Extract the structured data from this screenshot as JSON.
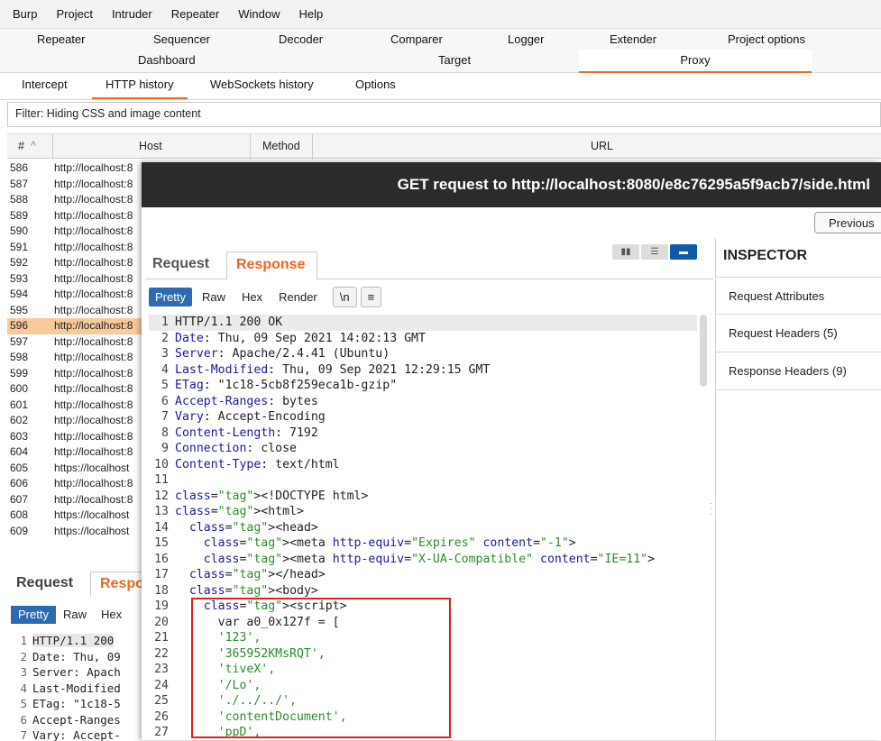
{
  "menu": [
    "Burp",
    "Project",
    "Intruder",
    "Repeater",
    "Window",
    "Help"
  ],
  "tool_tabs_row1": [
    "Repeater",
    "Sequencer",
    "Decoder",
    "Comparer",
    "Logger",
    "Extender",
    "Project options"
  ],
  "tool_tabs_row2": [
    "Dashboard",
    "Target",
    "Proxy"
  ],
  "proxy_tabs": [
    "Intercept",
    "HTTP history",
    "WebSockets history",
    "Options"
  ],
  "filter": "Filter: Hiding CSS and image content",
  "history": {
    "columns": [
      "#",
      "Host",
      "Method",
      "URL"
    ],
    "sort_indicator": "^",
    "rows": [
      {
        "num": "586",
        "host": "http://localhost:8"
      },
      {
        "num": "587",
        "host": "http://localhost:8"
      },
      {
        "num": "588",
        "host": "http://localhost:8"
      },
      {
        "num": "589",
        "host": "http://localhost:8"
      },
      {
        "num": "590",
        "host": "http://localhost:8"
      },
      {
        "num": "591",
        "host": "http://localhost:8"
      },
      {
        "num": "592",
        "host": "http://localhost:8"
      },
      {
        "num": "593",
        "host": "http://localhost:8"
      },
      {
        "num": "594",
        "host": "http://localhost:8"
      },
      {
        "num": "595",
        "host": "http://localhost:8"
      },
      {
        "num": "596",
        "host": "http://localhost:8"
      },
      {
        "num": "597",
        "host": "http://localhost:8"
      },
      {
        "num": "598",
        "host": "http://localhost:8"
      },
      {
        "num": "599",
        "host": "http://localhost:8"
      },
      {
        "num": "600",
        "host": "http://localhost:8"
      },
      {
        "num": "601",
        "host": "http://localhost:8"
      },
      {
        "num": "602",
        "host": "http://localhost:8"
      },
      {
        "num": "603",
        "host": "http://localhost:8"
      },
      {
        "num": "604",
        "host": "http://localhost:8"
      },
      {
        "num": "605",
        "host": "https://localhost"
      },
      {
        "num": "606",
        "host": "http://localhost:8"
      },
      {
        "num": "607",
        "host": "http://localhost:8"
      },
      {
        "num": "608",
        "host": "https://localhost"
      },
      {
        "num": "609",
        "host": "https://localhost"
      }
    ],
    "selected": "596"
  },
  "lower": {
    "tabs": [
      "Request",
      "Respo"
    ],
    "view": [
      "Pretty",
      "Raw",
      "Hex"
    ],
    "lines": [
      {
        "n": "1",
        "t": "HTTP/1.1 200"
      },
      {
        "n": "2",
        "t": "Date: Thu, 09"
      },
      {
        "n": "3",
        "t": "Server: Apach"
      },
      {
        "n": "4",
        "t": "Last-Modified"
      },
      {
        "n": "5",
        "t": "ETag: \"1c18-5"
      },
      {
        "n": "6",
        "t": "Accept-Ranges"
      },
      {
        "n": "7",
        "t": "Vary: Accept-"
      }
    ]
  },
  "popup": {
    "title": "GET request to http://localhost:8080/e8c76295a5f9acb7/side.html",
    "previous": "Previous",
    "tabs": {
      "request": "Request",
      "response": "Response"
    },
    "view_buttons": [
      "Pretty",
      "Raw",
      "Hex",
      "Render",
      "\\n",
      "≡"
    ],
    "lines": [
      "HTTP/1.1 200 OK",
      "Date: Thu, 09 Sep 2021 14:02:13 GMT",
      "Server: Apache/2.4.41 (Ubuntu)",
      "Last-Modified: Thu, 09 Sep 2021 12:29:15 GMT",
      "ETag: \"1c18-5cb8f259eca1b-gzip\"",
      "Accept-Ranges: bytes",
      "Vary: Accept-Encoding",
      "Content-Length: 7192",
      "Connection: close",
      "Content-Type: text/html",
      "",
      "<!DOCTYPE html>",
      "<html>",
      "  <head>",
      "    <meta http-equiv=\"Expires\" content=\"-1\">",
      "    <meta http-equiv=\"X-UA-Compatible\" content=\"IE=11\">",
      "  </head>",
      "  <body>",
      "    <script>",
      "      var a0_0x127f = [",
      "      '123',",
      "      '365952KMsRQT',",
      "      'tiveX',",
      "      '/Lo',",
      "      './../../',",
      "      'contentDocument',",
      "      'ppD',"
    ],
    "inspector": {
      "title": "INSPECTOR",
      "items": [
        "Request Attributes",
        "Request Headers (5)",
        "Response Headers (9)"
      ]
    }
  },
  "colors": {
    "accent": "#f26a22",
    "selected_row": "#f8c99a",
    "highlight_box": "#e02020",
    "title_bar": "#2b2b2b"
  }
}
